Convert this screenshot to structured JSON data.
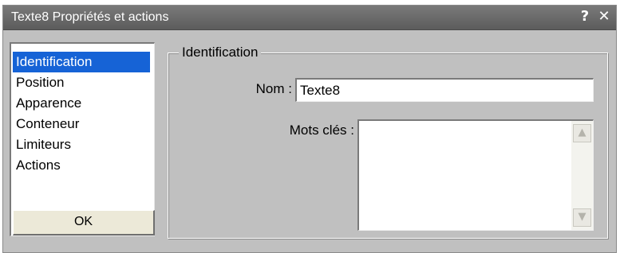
{
  "window": {
    "title": "Texte8 Propriétés et actions",
    "help_glyph": "?",
    "close_glyph": "✕"
  },
  "sidebar": {
    "items": [
      {
        "label": "Identification",
        "selected": true
      },
      {
        "label": "Position",
        "selected": false
      },
      {
        "label": "Apparence",
        "selected": false
      },
      {
        "label": "Conteneur",
        "selected": false
      },
      {
        "label": "Limiteurs",
        "selected": false
      },
      {
        "label": "Actions",
        "selected": false
      }
    ],
    "ok_label": "OK"
  },
  "panel": {
    "group_title": "Identification",
    "name_label": "Nom :",
    "name_value": "Texte8",
    "keywords_label": "Mots clés :",
    "keywords_value": ""
  },
  "icons": {
    "scroll_up": "chevron-up-icon",
    "scroll_down": "chevron-down-icon"
  },
  "colors": {
    "titlebar": "#6b6b6b",
    "selection": "#1663d6",
    "window_bg": "#c0c0c0"
  }
}
